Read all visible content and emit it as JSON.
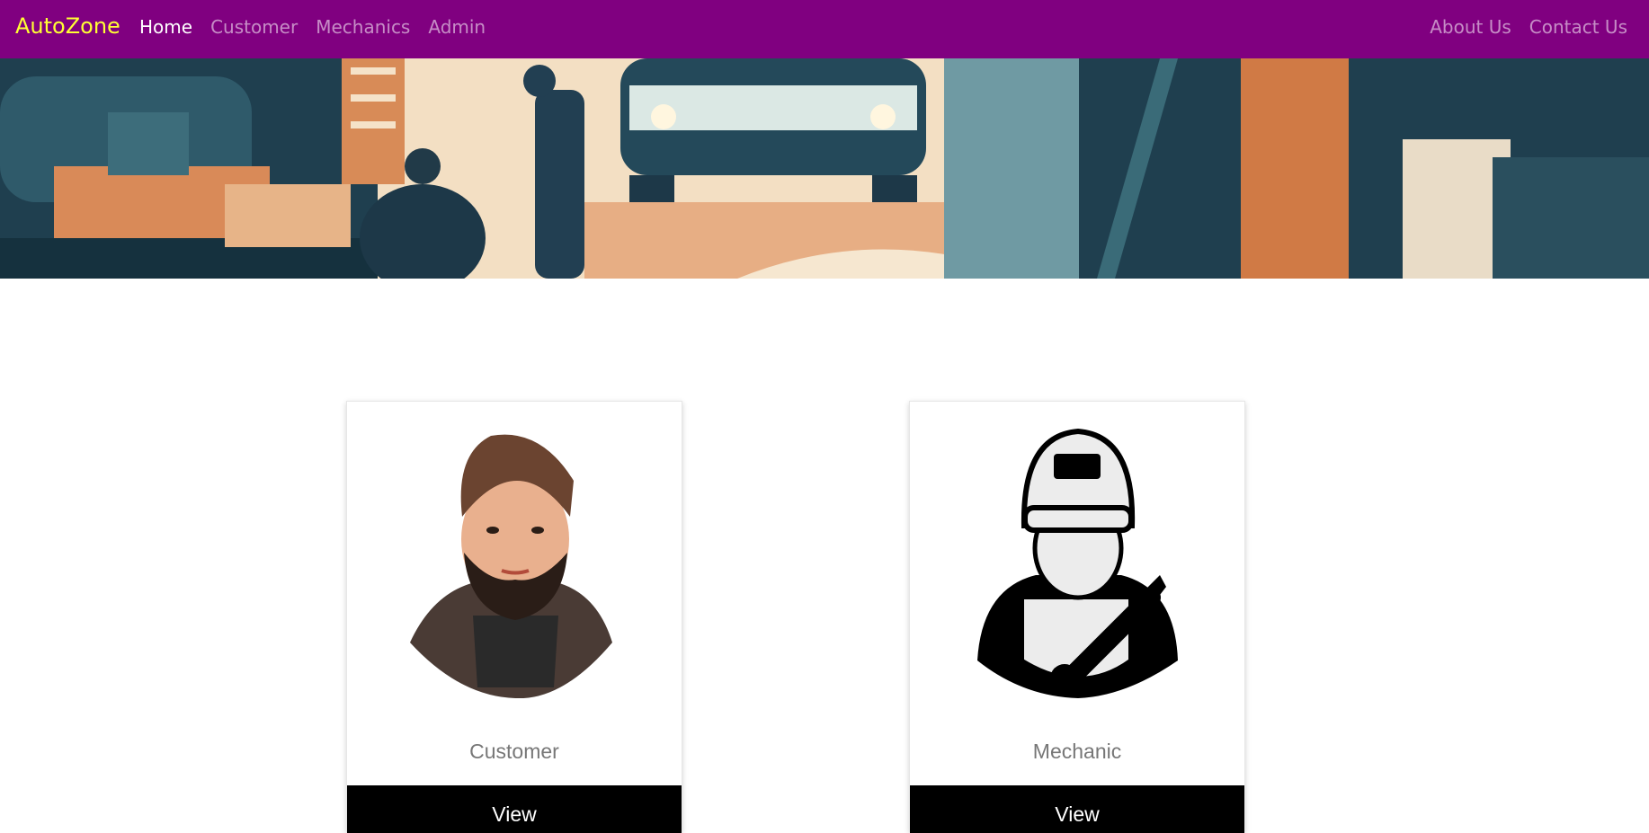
{
  "navbar": {
    "brand": "AutoZone",
    "left_links": [
      {
        "label": "Home",
        "active": true
      },
      {
        "label": "Customer",
        "active": false
      },
      {
        "label": "Mechanics",
        "active": false
      },
      {
        "label": "Admin",
        "active": false
      }
    ],
    "right_links": [
      {
        "label": "About Us"
      },
      {
        "label": "Contact Us"
      }
    ]
  },
  "hero": {
    "image": "garage-illustration"
  },
  "cards": [
    {
      "title": "Customer",
      "button": "View",
      "image": "bearded-man-avatar"
    },
    {
      "title": "Mechanic",
      "button": "View",
      "image": "mechanic-with-wrench-icon"
    }
  ],
  "colors": {
    "navbar_bg": "#800080",
    "brand": "#ffff33",
    "button_bg": "#000000"
  }
}
